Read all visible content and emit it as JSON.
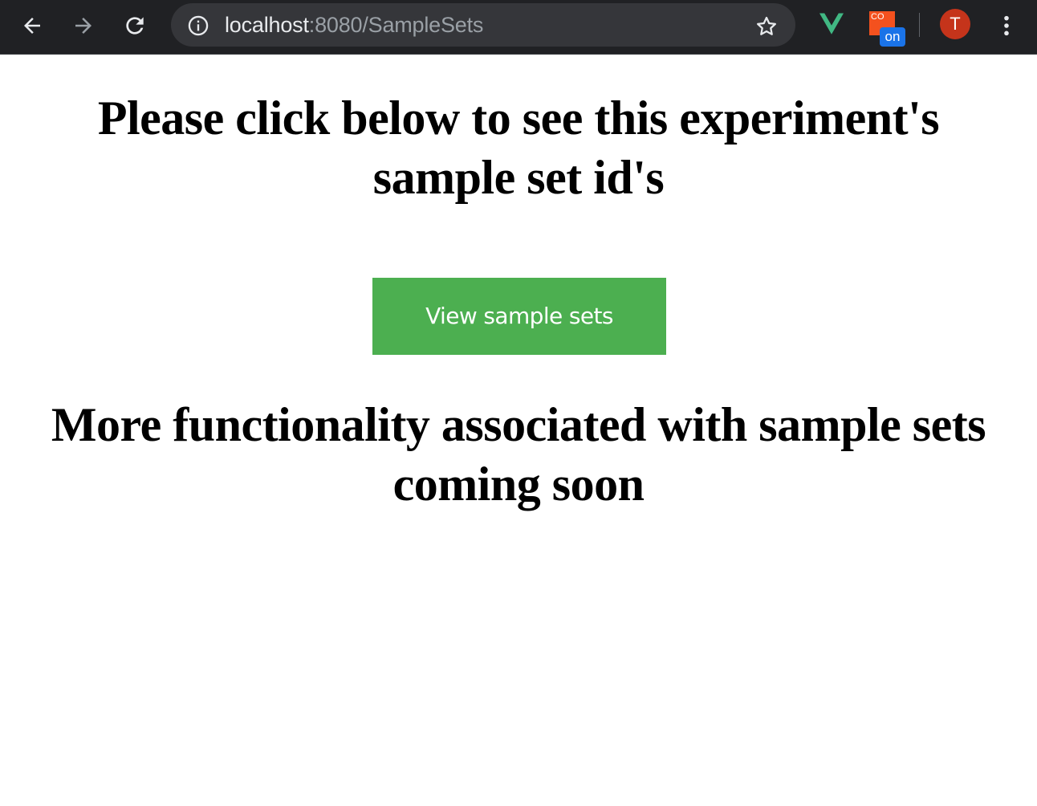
{
  "browser": {
    "url_host": "localhost",
    "url_path": ":8080/SampleSets",
    "extension_cors_label": "CO",
    "extension_cors_badge": "on",
    "avatar_initial": "T",
    "icons": {
      "back": "back-arrow-icon",
      "forward": "forward-arrow-icon",
      "reload": "reload-icon",
      "site_info": "info-icon",
      "bookmark": "star-icon",
      "vue": "vue-devtools-icon",
      "menu": "kebab-menu-icon"
    },
    "colors": {
      "toolbar": "#202124",
      "omnibox": "#35363a",
      "avatar": "#c5341b",
      "badge": "#1a73e8",
      "vue": "#41b883"
    }
  },
  "page": {
    "heading_top": "Please click below to see this experiment's sample set id's",
    "button_label": "View sample sets",
    "heading_bottom": "More functionality associated with sample sets coming soon",
    "colors": {
      "button_bg": "#4caf50",
      "button_text": "#ffffff",
      "text": "#000000"
    }
  }
}
